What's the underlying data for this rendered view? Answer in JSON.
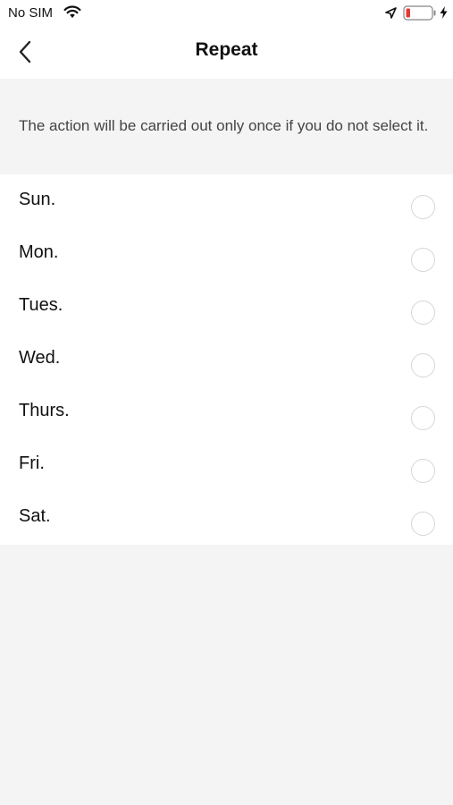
{
  "status_bar": {
    "carrier": "No SIM",
    "icons": [
      "wifi-icon",
      "location-arrow-icon",
      "battery-low-icon",
      "charging-bolt-icon"
    ],
    "battery_color": "#e53935"
  },
  "nav": {
    "title": "Repeat",
    "back_icon": "chevron-left-icon"
  },
  "hint": "The action will be carried out only once if you do not select it.",
  "days": [
    {
      "label": "Sun.",
      "selected": false
    },
    {
      "label": "Mon.",
      "selected": false
    },
    {
      "label": "Tues.",
      "selected": false
    },
    {
      "label": "Wed.",
      "selected": false
    },
    {
      "label": "Thurs.",
      "selected": false
    },
    {
      "label": "Fri.",
      "selected": false
    },
    {
      "label": "Sat.",
      "selected": false
    }
  ]
}
